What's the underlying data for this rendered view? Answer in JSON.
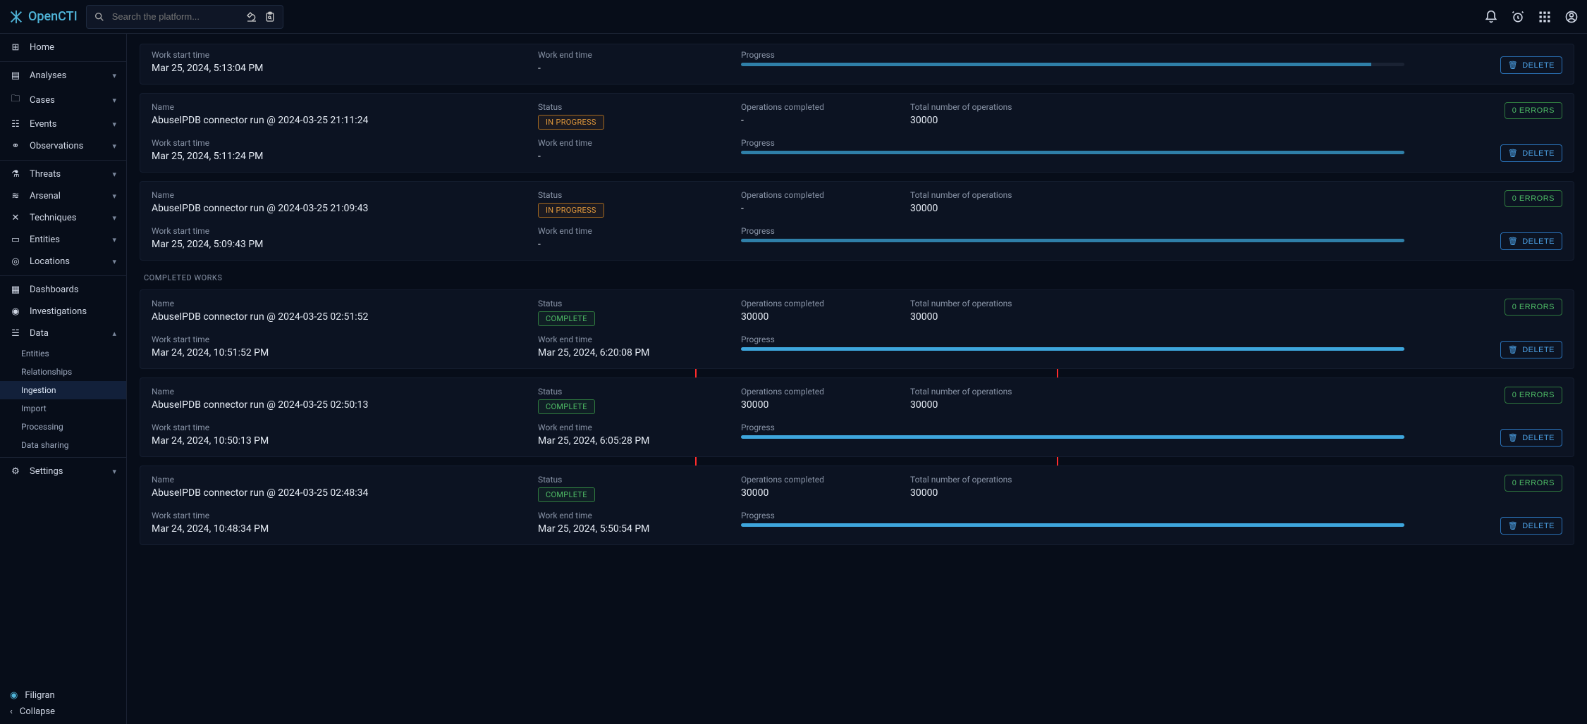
{
  "app": {
    "name": "OpenCTI"
  },
  "search": {
    "placeholder": "Search the platform..."
  },
  "nav": {
    "home": "Home",
    "analyses": "Analyses",
    "cases": "Cases",
    "events": "Events",
    "observations": "Observations",
    "threats": "Threats",
    "arsenal": "Arsenal",
    "techniques": "Techniques",
    "entities": "Entities",
    "locations": "Locations",
    "dashboards": "Dashboards",
    "investigations": "Investigations",
    "data": "Data",
    "data_sub": {
      "entities": "Entities",
      "relationships": "Relationships",
      "ingestion": "Ingestion",
      "import": "Import",
      "processing": "Processing",
      "data_sharing": "Data sharing"
    },
    "settings": "Settings",
    "filigran": "Filigran",
    "collapse": "Collapse"
  },
  "labels": {
    "name": "Name",
    "status": "Status",
    "ops_completed": "Operations completed",
    "total_ops": "Total number of operations",
    "work_start": "Work start time",
    "work_end": "Work end time",
    "progress": "Progress",
    "delete": "DELETE",
    "errors": "0 ERRORS",
    "in_progress": "IN PROGRESS",
    "complete": "COMPLETE",
    "completed_works": "COMPLETED WORKS"
  },
  "works": {
    "active": [
      {
        "name": "",
        "status": "",
        "ops_completed": "",
        "total_ops": "",
        "start": "Mar 25, 2024, 5:13:04 PM",
        "end": "-",
        "progress_label_only": true,
        "progress_pct": 95,
        "progress_partial": true
      },
      {
        "name": "AbuseIPDB connector run @ 2024-03-25 21:11:24",
        "status": "IN PROGRESS",
        "ops_completed": "-",
        "total_ops": "30000",
        "start": "Mar 25, 2024, 5:11:24 PM",
        "end": "-",
        "progress_pct": 100,
        "progress_partial": true
      },
      {
        "name": "AbuseIPDB connector run @ 2024-03-25 21:09:43",
        "status": "IN PROGRESS",
        "ops_completed": "-",
        "total_ops": "30000",
        "start": "Mar 25, 2024, 5:09:43 PM",
        "end": "-",
        "progress_pct": 100,
        "progress_partial": true
      }
    ],
    "completed": [
      {
        "name": "AbuseIPDB connector run @ 2024-03-25 02:51:52",
        "status": "COMPLETE",
        "ops_completed": "30000",
        "total_ops": "30000",
        "start": "Mar 24, 2024, 10:51:52 PM",
        "end": "Mar 25, 2024, 6:20:08 PM",
        "progress_pct": 100
      },
      {
        "name": "AbuseIPDB connector run @ 2024-03-25 02:50:13",
        "status": "COMPLETE",
        "ops_completed": "30000",
        "total_ops": "30000",
        "start": "Mar 24, 2024, 10:50:13 PM",
        "end": "Mar 25, 2024, 6:05:28 PM",
        "progress_pct": 100
      },
      {
        "name": "AbuseIPDB connector run @ 2024-03-25 02:48:34",
        "status": "COMPLETE",
        "ops_completed": "30000",
        "total_ops": "30000",
        "start": "Mar 24, 2024, 10:48:34 PM",
        "end": "Mar 25, 2024, 5:50:54 PM",
        "progress_pct": 100
      }
    ]
  }
}
